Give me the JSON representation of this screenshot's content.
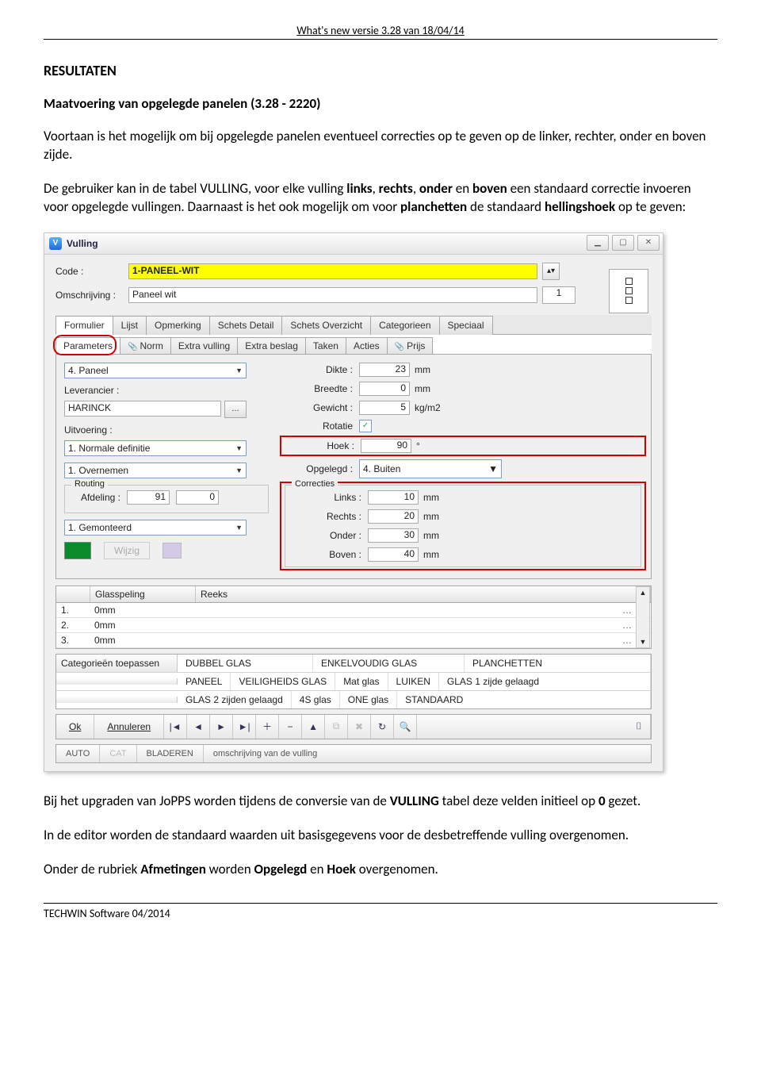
{
  "header": "What's new versie 3.28 van 18/04/14",
  "section_title": "RESULTATEN",
  "subsection": "Maatvoering van opgelegde panelen (3.28 - 2220)",
  "para1": "Voortaan is het mogelijk om bij opgelegde panelen eventueel correcties op te geven op de linker, rechter, onder en boven zijde.",
  "para2_a": "De gebruiker kan in de tabel VULLING, voor elke vulling ",
  "para2_links": "links",
  "para2_b": ", ",
  "para2_rechts": "rechts",
  "para2_c": ", ",
  "para2_onder": "onder",
  "para2_d": " en ",
  "para2_boven": "boven",
  "para2_e": " een standaard correctie invoeren voor opgelegde vullingen. Daarnaast is het ook mogelijk om voor ",
  "para2_plan": "planchetten",
  "para2_f": " de standaard ",
  "para2_hell": "hellingshoek",
  "para2_g": " op te geven:",
  "app": {
    "title": "Vulling",
    "win": {
      "min": "▁",
      "max": "▢",
      "close": "✕"
    },
    "code_label": "Code :",
    "code_value": "1-PANEEL-WIT",
    "desc_label": "Omschrijving :",
    "desc_value": "Paneel wit",
    "one": "1",
    "tabs1": [
      "Formulier",
      "Lijst",
      "Opmerking",
      "Schets Detail",
      "Schets Overzicht",
      "Categorieen",
      "Speciaal"
    ],
    "tabs1_active": 0,
    "tabs2": [
      {
        "label": "Parameters",
        "clip": false
      },
      {
        "label": "Norm",
        "clip": true
      },
      {
        "label": "Extra vulling",
        "clip": false
      },
      {
        "label": "Extra beslag",
        "clip": false
      },
      {
        "label": "Taken",
        "clip": false
      },
      {
        "label": "Acties",
        "clip": false
      },
      {
        "label": "Prijs",
        "clip": true
      }
    ],
    "tabs2_active": 0,
    "left": {
      "dd1": "4. Paneel",
      "lev_label": "Leverancier :",
      "lev_value": "HARINCK",
      "uit_label": "Uitvoering :",
      "dd2": "1. Normale definitie",
      "dd3": "1. Overnemen",
      "routing_legend": "Routing",
      "afd_label": "Afdeling :",
      "afd_v1": "91",
      "afd_v2": "0",
      "dd4": "1. Gemonteerd",
      "wijzig": "Wijzig"
    },
    "right": {
      "dikte_l": "Dikte :",
      "dikte_v": "23",
      "dikte_u": "mm",
      "breedte_l": "Breedte :",
      "breedte_v": "0",
      "breedte_u": "mm",
      "gewicht_l": "Gewicht :",
      "gewicht_v": "5",
      "gewicht_u": "kg/m2",
      "rotatie_l": "Rotatie",
      "rotatie_chk": "✓",
      "hoek_l": "Hoek :",
      "hoek_v": "90",
      "hoek_u": "°",
      "opgelegd_l": "Opgelegd :",
      "opgelegd_v": "4. Buiten",
      "corr_legend": "Correcties",
      "links_l": "Links :",
      "links_v": "10",
      "links_u": "mm",
      "rechts_l": "Rechts :",
      "rechts_v": "20",
      "rechts_u": "mm",
      "onder_l": "Onder :",
      "onder_v": "30",
      "onder_u": "mm",
      "boven_l": "Boven :",
      "boven_v": "40",
      "boven_u": "mm"
    },
    "table": {
      "headers": [
        "Glasspeling",
        "Reeks"
      ],
      "rows": [
        {
          "n": "1.",
          "v": "0mm"
        },
        {
          "n": "2.",
          "v": "0mm"
        },
        {
          "n": "3.",
          "v": "0mm"
        }
      ]
    },
    "cats": {
      "label": "Categorieën toepassen",
      "r1": [
        "DUBBEL GLAS",
        "ENKELVOUDIG GLAS",
        "PLANCHETTEN"
      ],
      "r2": [
        "PANEEL",
        "VEILIGHEIDS GLAS",
        "Mat glas",
        "LUIKEN",
        "GLAS 1 zijde gelaagd"
      ],
      "r3": [
        "GLAS 2 zijden gelaagd",
        "4S glas",
        "ONE glas",
        "STANDAARD"
      ]
    },
    "dlg": {
      "ok": "Ok",
      "cancel": "Annuleren",
      "first": "|◄",
      "prev": "◄",
      "next": "►",
      "last": "►|",
      "plus": "＋",
      "minus": "−",
      "up": "▲",
      "dup": "⧉",
      "del": "✖",
      "refresh": "↻",
      "find": "🔍"
    },
    "status": {
      "auto": "AUTO",
      "cat": "CAT",
      "bladeren": "BLADEREN",
      "desc": "omschrijving van de vulling"
    }
  },
  "para3_a": "Bij het upgraden van JoPPS worden tijdens de conversie van de ",
  "para3_b": "VULLING",
  "para3_c": " tabel deze velden initieel op ",
  "para3_d": "0",
  "para3_e": " gezet.",
  "para4": "In de editor worden de standaard waarden uit basisgegevens voor de desbetreffende vulling overgenomen.",
  "para5_a": "Onder de rubriek ",
  "para5_b": "Afmetingen",
  "para5_c": " worden ",
  "para5_d": "Opgelegd",
  "para5_e": " en ",
  "para5_f": "Hoek",
  "para5_g": " overgenomen.",
  "footer": "TECHWIN Software 04/2014"
}
